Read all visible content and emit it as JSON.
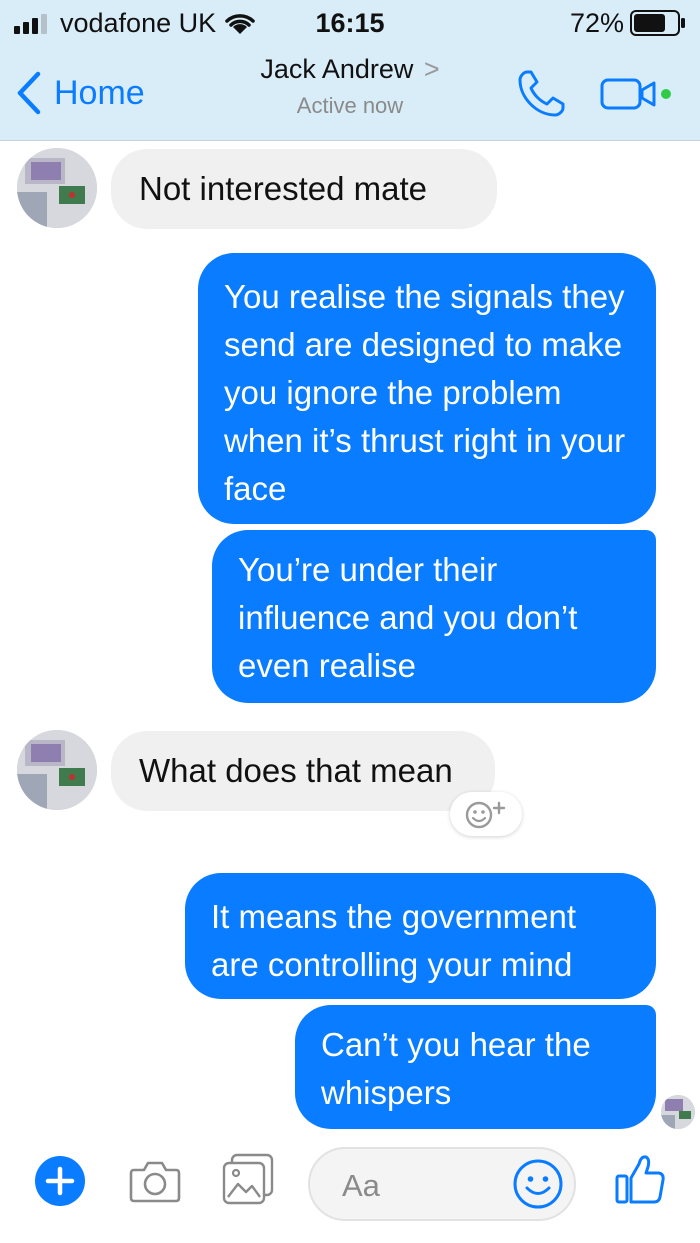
{
  "status_bar": {
    "carrier": "vodafone UK",
    "time": "16:15",
    "battery_percent": "72%"
  },
  "header": {
    "back_label": "Home",
    "contact_name": "Jack Andrew",
    "title_chevron": ">",
    "status": "Active now"
  },
  "messages": [
    {
      "direction": "incoming",
      "text": "Not interested mate"
    },
    {
      "direction": "outgoing",
      "text": "You realise the signals they send are designed to make you ignore the problem when it’s thrust right in your face"
    },
    {
      "direction": "outgoing",
      "text": "You’re under their influence and you don’t even realise"
    },
    {
      "direction": "incoming",
      "text": "What does that mean"
    },
    {
      "direction": "outgoing",
      "text": "It means the government are controlling your mind"
    },
    {
      "direction": "outgoing",
      "text": "Can’t you hear the whispers"
    }
  ],
  "composer": {
    "placeholder": "Aa"
  },
  "colors": {
    "accent": "#0a7cff",
    "header_bg": "#d9edf9",
    "incoming_bubble": "#f0f0f0",
    "online_dot": "#31cc46"
  },
  "icons": {
    "phone": "phone-icon",
    "video": "video-camera-icon",
    "plus": "plus-icon",
    "camera": "camera-icon",
    "image": "image-gallery-icon",
    "emoji": "smiley-icon",
    "like": "thumbs-up-icon",
    "reaction": "add-reaction-icon"
  }
}
